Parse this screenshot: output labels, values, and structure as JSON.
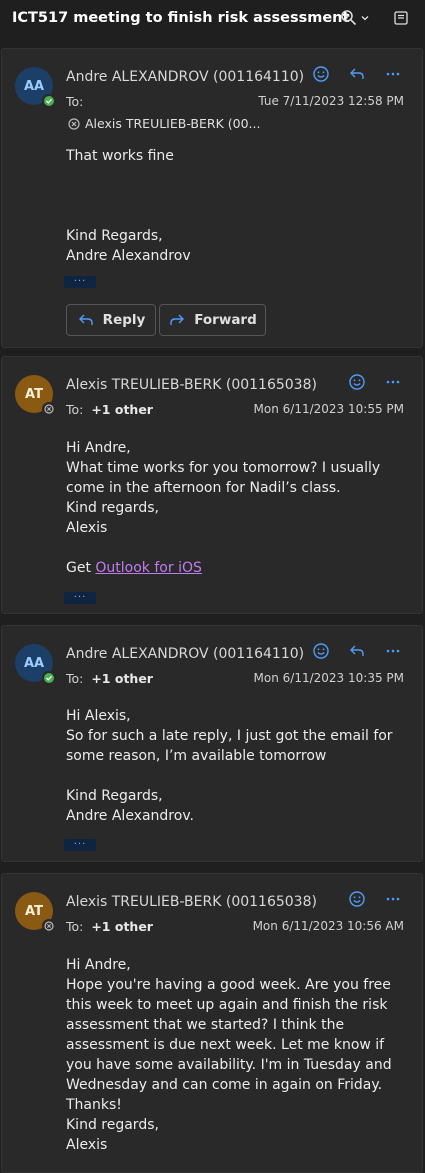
{
  "header": {
    "subject": "ICT517 meeting to finish risk assessment"
  },
  "messages": [
    {
      "initials": "AA",
      "sender": "Andre ALEXANDROV (001164110)",
      "to_label": "To:",
      "recipient": "Alexis TREULIEB-BERK (00...",
      "date": "Tue 7/11/2023 12:58 PM",
      "body": [
        "That works fine",
        "",
        "",
        "",
        "Kind Regards,",
        "Andre Alexandrov"
      ],
      "reply_label": "Reply",
      "forward_label": "Forward"
    },
    {
      "initials": "AT",
      "sender": "Alexis TREULIEB-BERK (001165038)",
      "to_label": "To:",
      "others": "+1 other",
      "date": "Mon 6/11/2023 10:55 PM",
      "body": [
        "Hi Andre,",
        "What time works for you tomorrow? I usually",
        "come in the afternoon for Nadil’s class.",
        "Kind regards,",
        "Alexis",
        ""
      ],
      "get_text": "Get ",
      "link_text": "Outlook for iOS"
    },
    {
      "initials": "AA",
      "sender": "Andre ALEXANDROV (001164110)",
      "to_label": "To:",
      "others": "+1 other",
      "date": "Mon 6/11/2023 10:35 PM",
      "body": [
        "Hi Alexis,",
        "So for such a late reply, I just got the email for",
        "some reason, I’m available tomorrow",
        "",
        "Kind Regards,",
        "Andre Alexandrov."
      ]
    },
    {
      "initials": "AT",
      "sender": "Alexis TREULIEB-BERK (001165038)",
      "to_label": "To:",
      "others": "+1 other",
      "date": "Mon 6/11/2023 10:56 AM",
      "body": [
        "Hi Andre,",
        "Hope you're having a good week. Are you free",
        "this week to meet up again and finish the risk",
        "assessment that we started? I think the",
        "assessment is due next week. Let me know if",
        "you have some availability. I'm in Tuesday and",
        "Wednesday and can come in again on Friday.",
        "Thanks!",
        "Kind regards,",
        "Alexis"
      ]
    }
  ],
  "colors": {
    "background": "#1f1f1f",
    "card": "#292929",
    "accent": "#4f9cf9",
    "link": "#c27cf0"
  },
  "icons": [
    "zoom-icon",
    "chevron-down-icon",
    "popout-icon",
    "emoji-icon",
    "reply-icon",
    "more-icon",
    "forward-icon",
    "blocked-icon"
  ]
}
